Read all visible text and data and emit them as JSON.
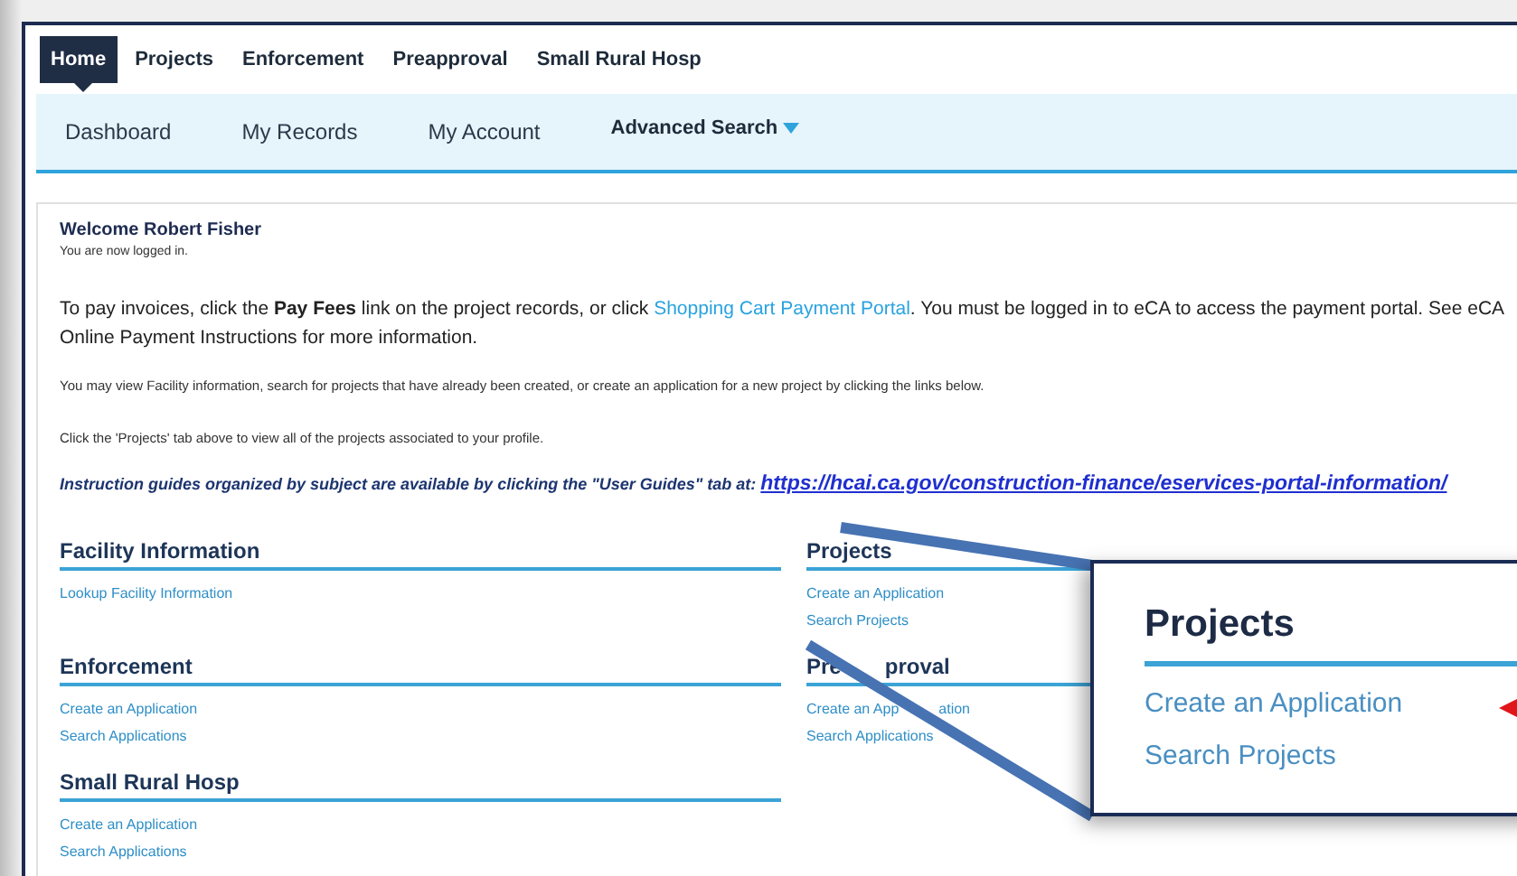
{
  "top_tabs": [
    {
      "label": "Home",
      "selected": true
    },
    {
      "label": "Projects",
      "selected": false
    },
    {
      "label": "Enforcement",
      "selected": false
    },
    {
      "label": "Preapproval",
      "selected": false
    },
    {
      "label": "Small Rural Hosp",
      "selected": false
    }
  ],
  "sub_nav": [
    {
      "label": "Dashboard",
      "kind": "link"
    },
    {
      "label": "My Records",
      "kind": "link"
    },
    {
      "label": "My Account",
      "kind": "link"
    },
    {
      "label": "Advanced Search",
      "kind": "dropdown"
    }
  ],
  "welcome": {
    "title": "Welcome Robert Fisher",
    "status": "You are now logged in."
  },
  "payment": {
    "before": "To pay invoices, click the **Pay Fees** link on the project records, or click ",
    "link": "Shopping Cart Payment Portal",
    "after": ". You must be logged in to eCA to access the payment portal. See eCA Online Payment Instructions for more information."
  },
  "notes": [
    "You may view Facility information, search for projects that have already been created, or create an application for a new project by clicking the links below.",
    "Click the 'Projects' tab above to view all of the projects associated to your profile."
  ],
  "guides": {
    "text": "Instruction guides organized by subject are available by clicking the  \"User Guides\" tab at:",
    "link": "https://hcai.ca.gov/construction-finance/eservices-portal-information/"
  },
  "sections_left": [
    {
      "title": "Facility Information",
      "links": [
        "Lookup Facility Information"
      ]
    },
    {
      "title": "Enforcement",
      "links": [
        "Create an Application",
        "Search Applications"
      ]
    },
    {
      "title": "Small Rural Hosp",
      "links": [
        "Create an Application",
        "Search Applications"
      ]
    }
  ],
  "sections_right": [
    {
      "title_parts": [
        "Projects"
      ],
      "links": [
        [
          "Create an Application"
        ],
        [
          "Search Projects"
        ]
      ]
    },
    {
      "title_parts": [
        "Pre",
        "proval"
      ],
      "links": [
        [
          "Create an App",
          "ation"
        ],
        [
          "Search Applications"
        ]
      ]
    }
  ],
  "callout": {
    "title": "Projects",
    "links": [
      "Create an Application",
      "Search Projects"
    ]
  }
}
